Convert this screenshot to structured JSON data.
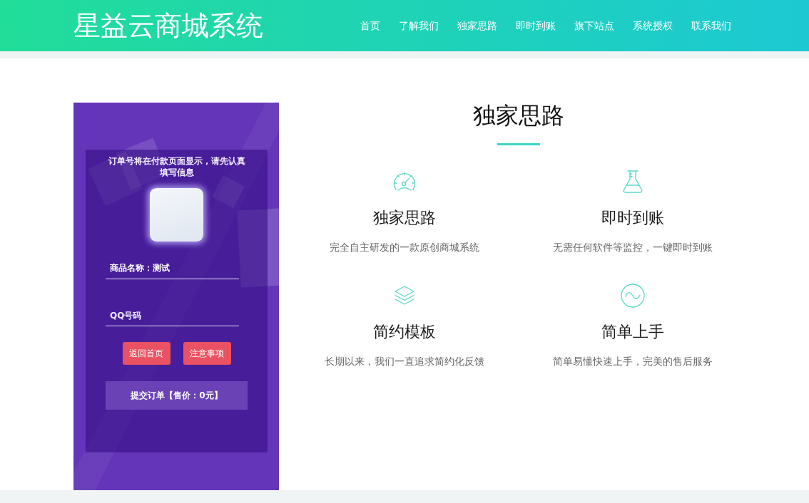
{
  "header": {
    "logo": "星益云商城系统",
    "nav": [
      {
        "label": "首页"
      },
      {
        "label": "了解我们"
      },
      {
        "label": "独家思路"
      },
      {
        "label": "即时到账"
      },
      {
        "label": "旗下站点"
      },
      {
        "label": "系统授权"
      },
      {
        "label": "联系我们"
      }
    ]
  },
  "order_form": {
    "notice": "订单号将在付款页面显示，请先认真填写信息",
    "product_field": {
      "value": "商品名称：测试"
    },
    "qq_field": {
      "placeholder": "QQ号码"
    },
    "buttons": [
      {
        "label": "返回首页"
      },
      {
        "label": "注意事项"
      }
    ],
    "submit": {
      "label": "提交订单【售价：0元】"
    }
  },
  "features": {
    "title": "独家思路",
    "items": [
      {
        "title": "独家思路",
        "description": "完全自主研发的一款原创商城系统"
      },
      {
        "title": "即时到账",
        "description": "无需任何软件等监控，一键即时到账"
      },
      {
        "title": "简约模板",
        "description": "长期以来，我们一直追求简约化反馈"
      },
      {
        "title": "简单上手",
        "description": "简单易懂快速上手，完美的售后服务"
      }
    ]
  }
}
